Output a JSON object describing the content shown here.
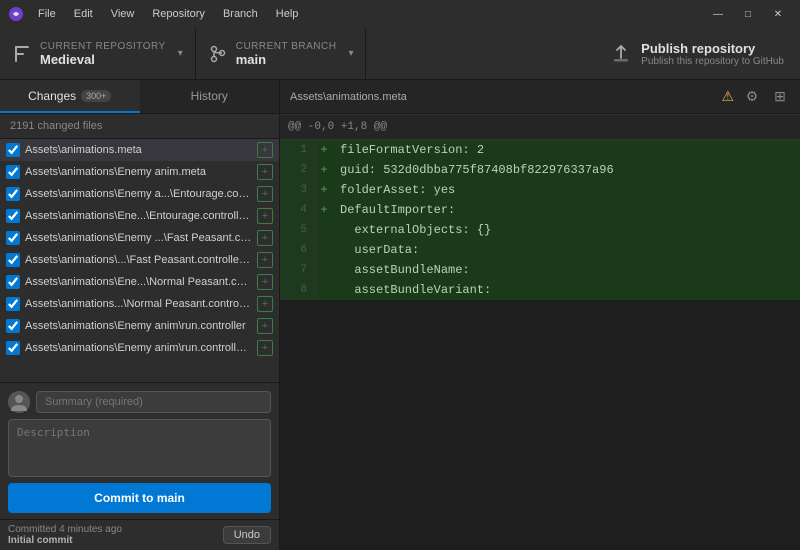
{
  "titlebar": {
    "app_icon": "●",
    "menu": [
      "File",
      "Edit",
      "View",
      "Repository",
      "Branch",
      "Help"
    ],
    "controls": [
      "—",
      "□",
      "✕"
    ]
  },
  "toolbar": {
    "repo_label": "Current repository",
    "repo_name": "Medieval",
    "branch_label": "Current branch",
    "branch_name": "main",
    "publish_title": "Publish repository",
    "publish_subtitle": "Publish this repository to GitHub"
  },
  "left_panel": {
    "tab_changes": "Changes",
    "tab_changes_badge": "300+",
    "tab_history": "History",
    "file_count": "2191 changed files",
    "files": [
      {
        "name": "Assets\\animations.meta",
        "checked": true
      },
      {
        "name": "Assets\\animations\\Enemy anim.meta",
        "checked": true
      },
      {
        "name": "Assets\\animations\\Enemy a...\\Entourage.controller",
        "checked": true
      },
      {
        "name": "Assets\\animations\\Ene...\\Entourage.controller.meta",
        "checked": true
      },
      {
        "name": "Assets\\animations\\Enemy ...\\Fast Peasant.controller",
        "checked": true
      },
      {
        "name": "Assets\\animations\\...\\Fast Peasant.controller.meta",
        "checked": true
      },
      {
        "name": "Assets\\animations\\Ene...\\Normal Peasant.controller",
        "checked": true
      },
      {
        "name": "Assets\\animations...\\Normal Peasant.controller.meta",
        "checked": true
      },
      {
        "name": "Assets\\animations\\Enemy anim\\run.controller",
        "checked": true
      },
      {
        "name": "Assets\\animations\\Enemy anim\\run.controller.meta",
        "checked": true
      }
    ],
    "summary_placeholder": "Summary (required)",
    "description_placeholder": "Description",
    "commit_btn": "Commit to main",
    "footer_time": "Committed 4 minutes ago",
    "footer_commit": "Initial commit",
    "undo_btn": "Undo"
  },
  "right_panel": {
    "diff_path": "Assets\\animations.meta",
    "hunk_header": "@@ -0,0 +1,8 @@",
    "diff_lines": [
      {
        "num": "1",
        "type": "added",
        "content": "+fileFormatVersion: 2"
      },
      {
        "num": "2",
        "type": "added",
        "content": "+guid: 532d0dbba775f87408bf822976337a96"
      },
      {
        "num": "3",
        "type": "added",
        "content": "+folderAsset: yes"
      },
      {
        "num": "4",
        "type": "added",
        "content": "+DefaultImporter:"
      },
      {
        "num": "5",
        "type": "added",
        "content": "  externalObjects: {}"
      },
      {
        "num": "6",
        "type": "added",
        "content": "  userData:"
      },
      {
        "num": "7",
        "type": "added",
        "content": "  assetBundleName:"
      },
      {
        "num": "8",
        "type": "added",
        "content": "  assetBundleVariant:"
      }
    ]
  }
}
